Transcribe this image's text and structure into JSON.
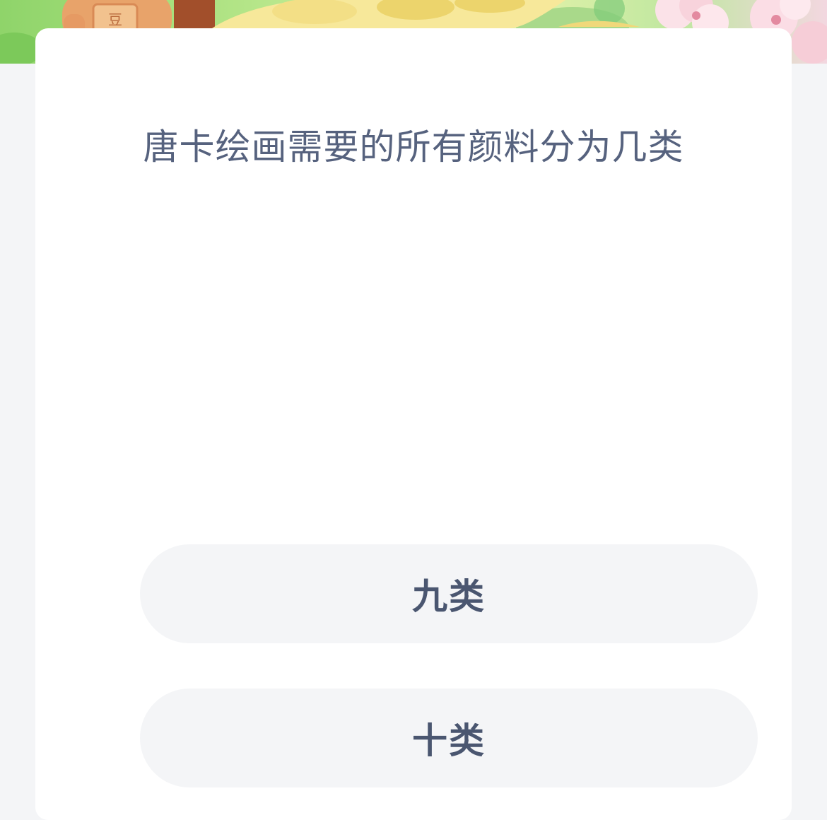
{
  "question": {
    "text": "唐卡绘画需要的所有颜料分为几类"
  },
  "options": [
    {
      "label": "九类"
    },
    {
      "label": "十类"
    }
  ],
  "colors": {
    "question_text": "#56627e",
    "option_text": "#4a5670",
    "option_background": "#f4f5f7",
    "card_background": "#ffffff",
    "page_background": "#f4f5f7",
    "banner_green": "#8fd46a"
  },
  "banner": {
    "icons": [
      "character-icon",
      "flower-icon"
    ]
  }
}
